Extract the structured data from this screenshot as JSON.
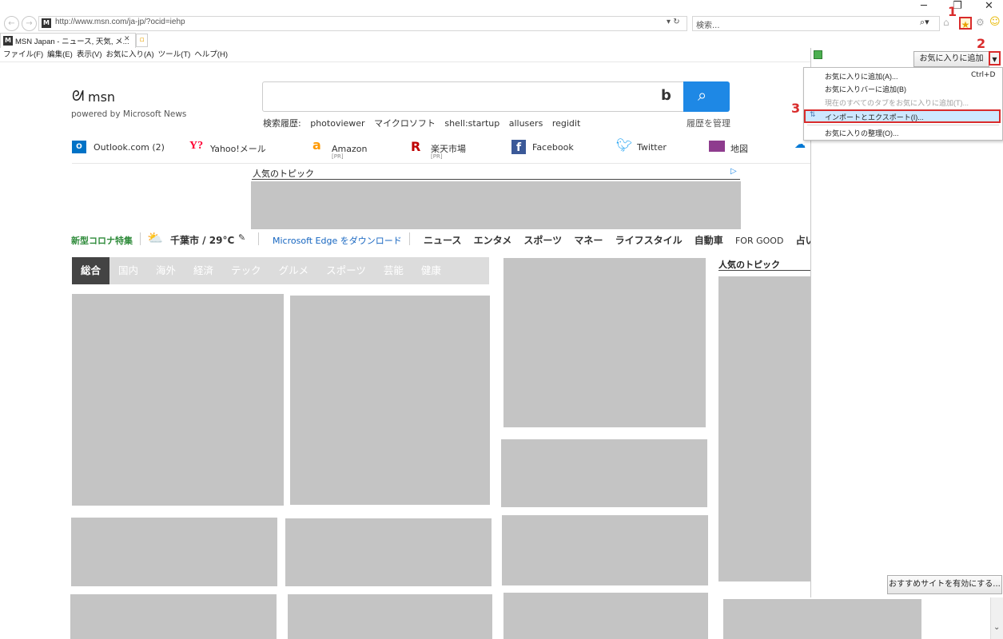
{
  "browser": {
    "url": "http://www.msn.com/ja-jp/?ocid=iehp",
    "search_placeholder": "検索...",
    "tab_title": "MSN Japan - ニュース, 天気, メ...",
    "favicon_letter": "M",
    "menu": [
      "ファイル(F)",
      "編集(E)",
      "表示(V)",
      "お気に入り(A)",
      "ツール(T)",
      "ヘルプ(H)"
    ]
  },
  "page": {
    "logo": "msn",
    "tagline": "powered by Microsoft News",
    "search_history_label": "検索履歴:",
    "search_history": [
      "photoviewer",
      "マイクロソフト",
      "shell:startup",
      "allusers",
      "regidit"
    ],
    "manage_history": "履歴を管理",
    "quicklinks": [
      {
        "label": "Outlook.com (2)",
        "icon": "outlook-icon",
        "color": "#0072c6",
        "pr": ""
      },
      {
        "label": "Yahoo!メール",
        "icon": "yahoo-icon",
        "color": "#ff0033",
        "pr": ""
      },
      {
        "label": "Amazon",
        "icon": "amazon-icon",
        "color": "#ff9900",
        "pr": "[PR]"
      },
      {
        "label": "楽天市場",
        "icon": "rakuten-icon",
        "color": "#bf0000",
        "pr": "[PR]"
      },
      {
        "label": "Facebook",
        "icon": "facebook-icon",
        "color": "#3b5998",
        "pr": ""
      },
      {
        "label": "Twitter",
        "icon": "twitter-icon",
        "color": "#1da1f2",
        "pr": ""
      },
      {
        "label": "地図",
        "icon": "map-icon",
        "color": "#8e3c8e",
        "pr": ""
      }
    ],
    "ad_label": "人気のトピック",
    "covid_label": "新型コロナ特集",
    "weather": "千葉市 / 29°C",
    "edge_link": "Microsoft Edge をダウンロード",
    "nav": [
      "ニュース",
      "エンタメ",
      "スポーツ",
      "マネー",
      "ライフスタイル",
      "自動車",
      "FOR GOOD",
      "占い"
    ],
    "news_tabs": [
      "総合",
      "国内",
      "海外",
      "経済",
      "テック",
      "グルメ",
      "スポーツ",
      "芸能",
      "健康"
    ],
    "side_topic": "人気のトピック"
  },
  "favorites": {
    "add_button": "お気に入りに追加",
    "menu": [
      {
        "label": "お気に入りに追加(A)...",
        "shortcut": "Ctrl+D",
        "disabled": false
      },
      {
        "label": "お気に入りバーに追加(B)",
        "shortcut": "",
        "disabled": false
      },
      {
        "label": "現在のすべてのタブをお気に入りに追加(T)...",
        "shortcut": "",
        "disabled": true
      },
      {
        "label": "インポートとエクスポート(I)...",
        "shortcut": "",
        "disabled": false
      },
      {
        "label": "お気に入りの整理(O)...",
        "shortcut": "",
        "disabled": false
      }
    ],
    "recommend_button": "おすすめサイトを有効にする..."
  },
  "annotations": [
    "1",
    "2",
    "3"
  ]
}
